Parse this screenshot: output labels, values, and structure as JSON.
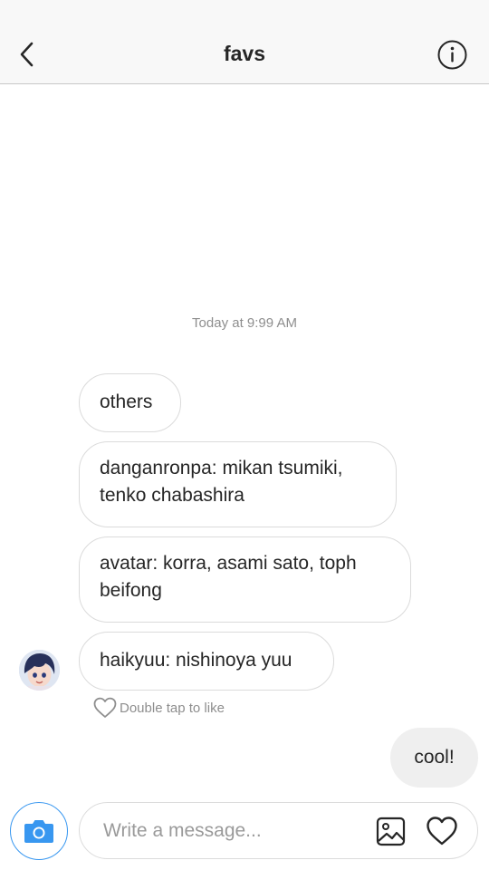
{
  "header": {
    "title": "favs",
    "back_icon": "chevron-left-icon",
    "info_icon": "info-icon"
  },
  "thread": {
    "timestamp": "Today at 9:99 AM",
    "received_messages": [
      {
        "lines": [
          "others"
        ]
      },
      {
        "lines": [
          "danganronpa: mikan tsumiki,",
          "tenko chabashira"
        ]
      },
      {
        "lines": [
          "avatar: korra, asami sato, toph",
          "beifong"
        ]
      },
      {
        "lines": [
          "haikyuu: nishinoya yuu"
        ]
      }
    ],
    "like_hint": "Double tap to like",
    "sent_messages": [
      {
        "text": "cool!"
      }
    ]
  },
  "composer": {
    "placeholder": "Write a message...",
    "value": "",
    "camera_icon": "camera-icon",
    "gallery_icon": "image-icon",
    "heart_icon": "heart-icon"
  },
  "colors": {
    "accent": "#3897f0",
    "bubble_border": "#dbdbdb",
    "sent_bubble_bg": "#efefef",
    "muted_text": "#8e8e8e"
  }
}
